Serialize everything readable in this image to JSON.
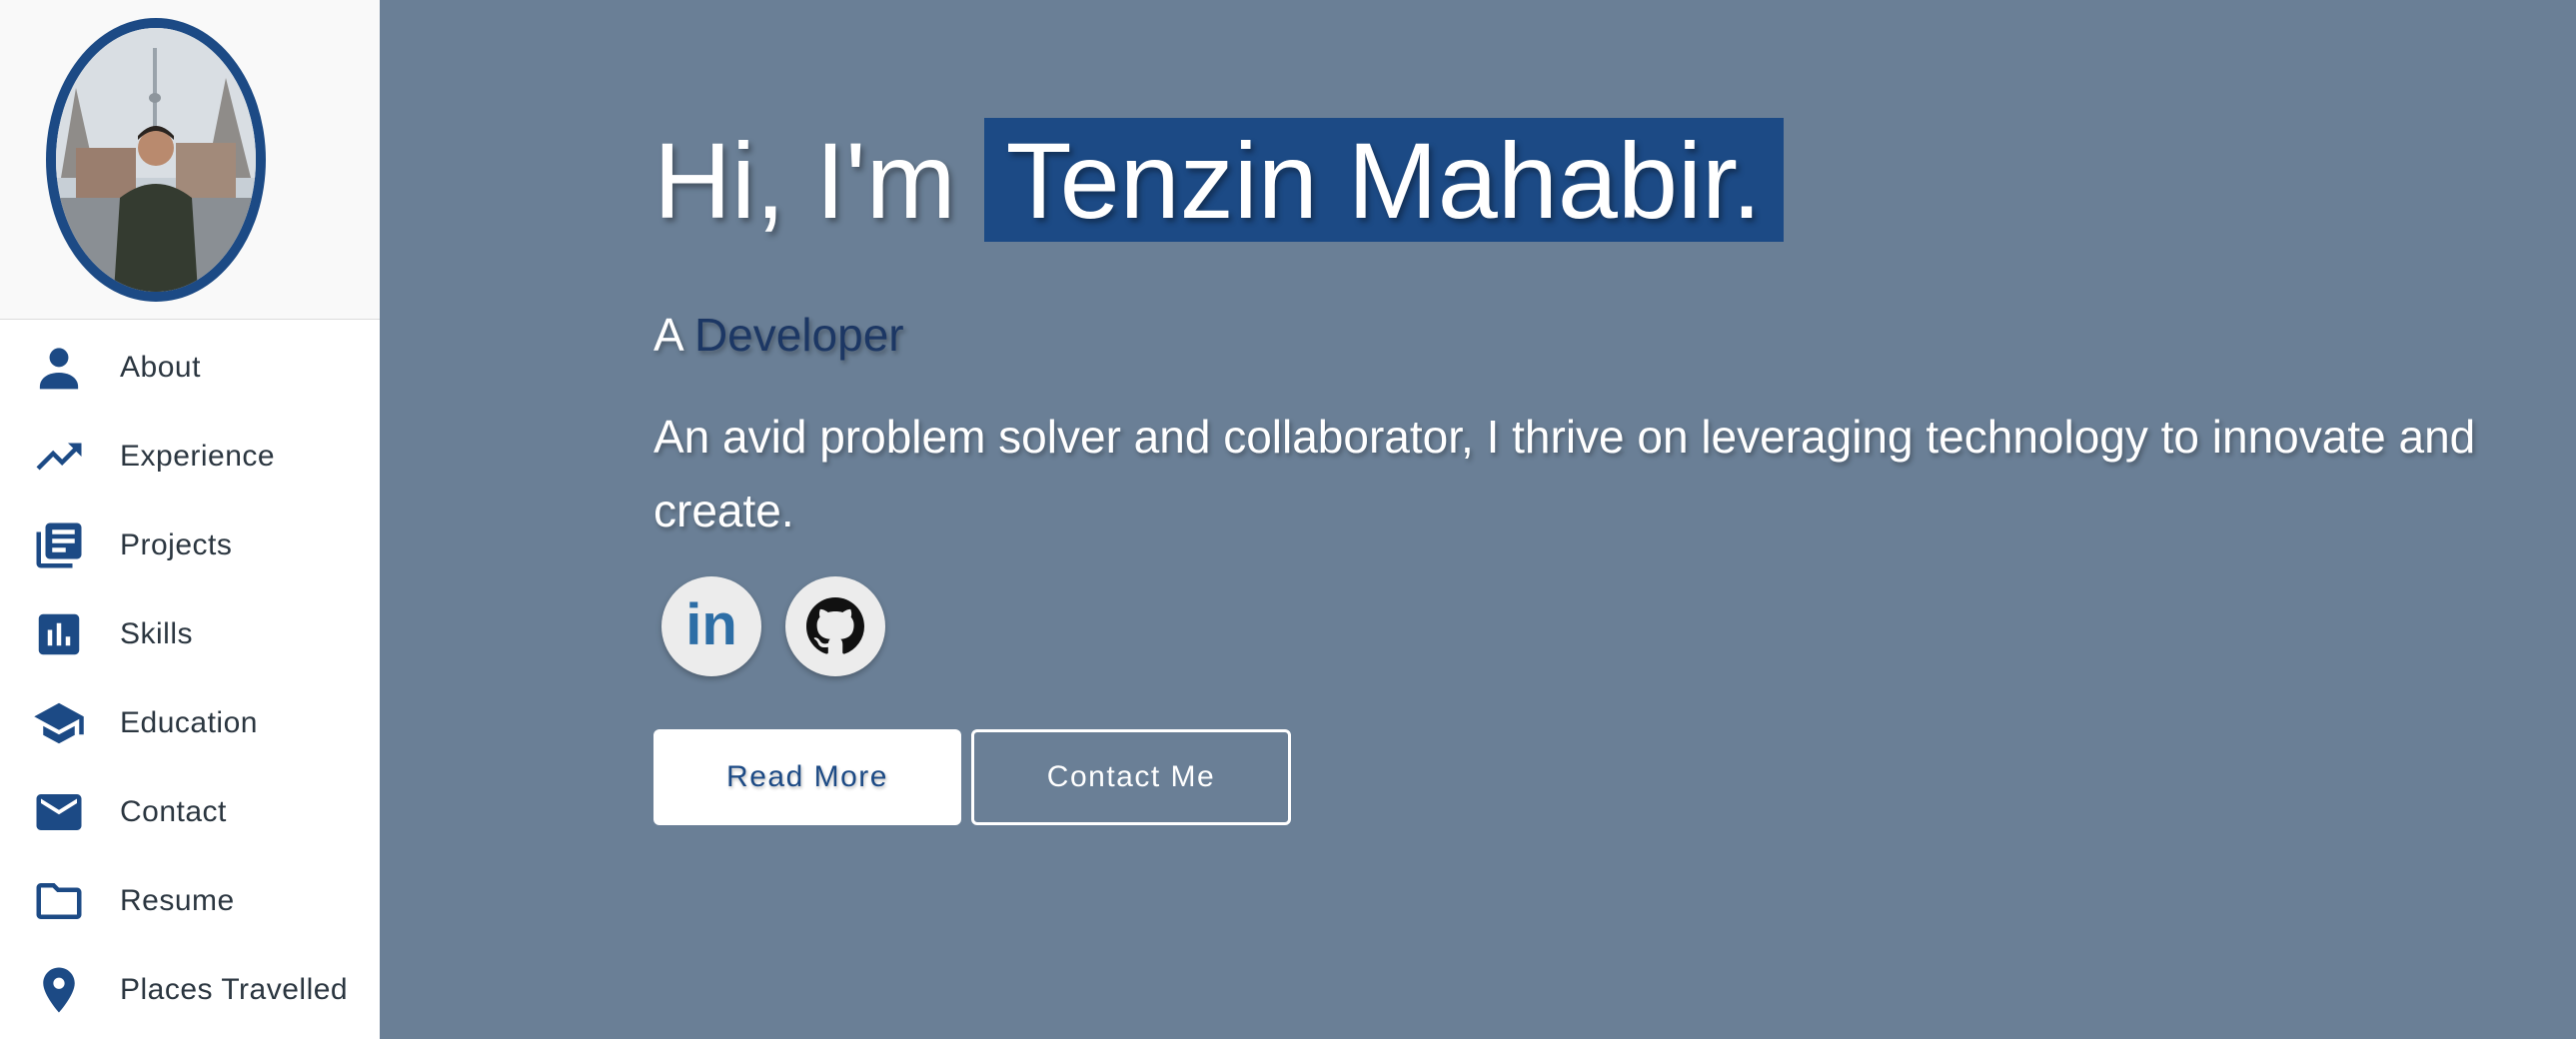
{
  "sidebar": {
    "items": [
      {
        "label": "About",
        "icon": "person-icon"
      },
      {
        "label": "Experience",
        "icon": "trending-up-icon"
      },
      {
        "label": "Projects",
        "icon": "library-books-icon"
      },
      {
        "label": "Skills",
        "icon": "bar-chart-icon"
      },
      {
        "label": "Education",
        "icon": "graduation-cap-icon"
      },
      {
        "label": "Contact",
        "icon": "mail-icon"
      },
      {
        "label": "Resume",
        "icon": "folder-icon"
      },
      {
        "label": "Places Travelled",
        "icon": "location-pin-icon"
      }
    ]
  },
  "hero": {
    "greeting": "Hi, I'm",
    "name": "Tenzin Mahabir.",
    "role_prefix": "A",
    "role": "Developer",
    "tagline": "An avid problem solver and collaborator, I thrive on leveraging technology to innovate and create."
  },
  "social": {
    "linkedin_text": "in"
  },
  "buttons": {
    "read_more": "Read More",
    "contact_me": "Contact Me"
  },
  "colors": {
    "accent": "#1c4a85",
    "background": "#6a7f96",
    "sidebar": "#ffffff",
    "linkedin": "#2d6ea6"
  }
}
